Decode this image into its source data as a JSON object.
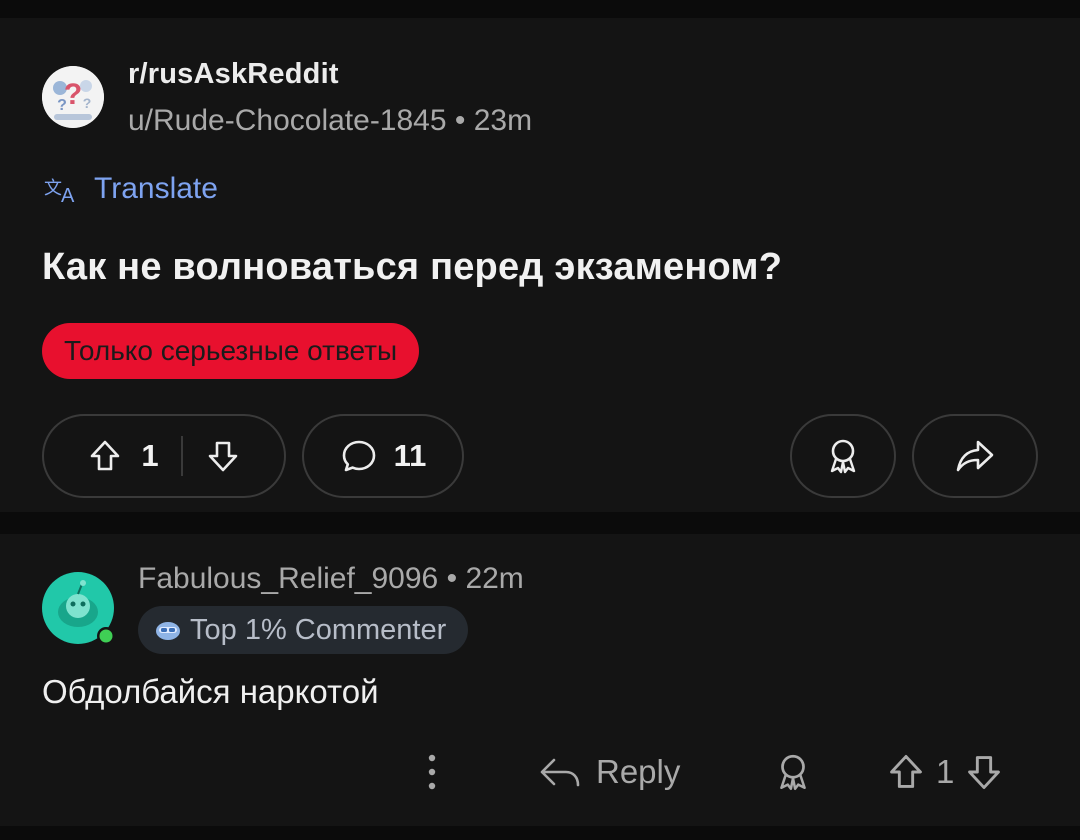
{
  "post": {
    "subreddit": "r/rusAskReddit",
    "author": "u/Rude-Chocolate-1845",
    "separator": "•",
    "age": "23m",
    "translate_label": "Translate",
    "title": "Как не волноваться перед экзаменом?",
    "flair": "Только серьезные ответы",
    "votes": "1",
    "comments": "11"
  },
  "comment": {
    "username": "Fabulous_Relief_9096",
    "separator": "•",
    "age": "22m",
    "badge": "Top 1% Commenter",
    "text": "Обдолбайся наркотой",
    "reply_label": "Reply",
    "votes": "1"
  },
  "colors": {
    "background": "#141414",
    "flair": "#e8102e",
    "translate": "#7ea3f0",
    "avatar_teal": "#21c8a9",
    "online_dot": "#3fcf55"
  },
  "icons": [
    "translate-icon",
    "upvote-icon",
    "downvote-icon",
    "comment-icon",
    "award-icon",
    "share-icon",
    "more-options-icon",
    "reply-icon"
  ]
}
